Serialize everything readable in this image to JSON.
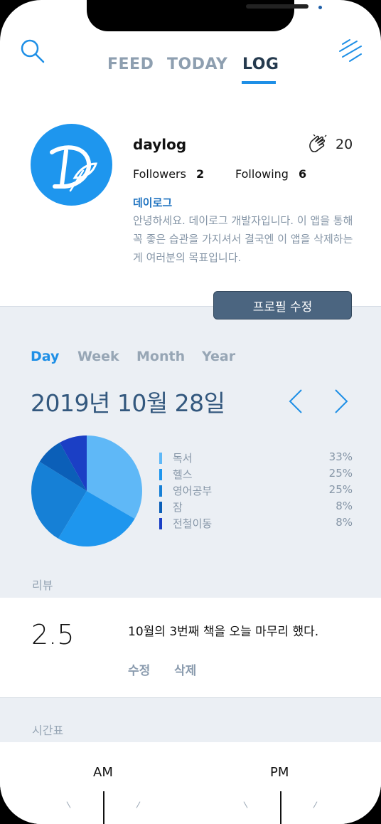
{
  "nav": {
    "tabs": [
      "FEED",
      "TODAY",
      "LOG"
    ],
    "active_tab": "LOG"
  },
  "profile": {
    "username": "daylog",
    "clap_count": "20",
    "followers_label": "Followers",
    "followers_count": "2",
    "following_label": "Following",
    "following_count": "6",
    "display_name": "데이로그",
    "bio": "안녕하세요. 데이로그 개발자입니다. 이 앱을 통해 꼭 좋은 습관을 가지셔서 결국엔 이 앱을 삭제하는게 여러분의 목표입니다.",
    "edit_button": "프로필 수정"
  },
  "periods": [
    "Day",
    "Week",
    "Month",
    "Year"
  ],
  "active_period": "Day",
  "current_date": "2019년 10월 28일",
  "chart_data": {
    "type": "pie",
    "labels": [
      "독서",
      "헬스",
      "영어공부",
      "잠",
      "전철이동"
    ],
    "values": [
      33,
      25,
      25,
      8,
      8
    ],
    "value_labels": [
      "33%",
      "25%",
      "25%",
      "8%",
      "8%"
    ],
    "colors": [
      "#5fb8f7",
      "#1e96ee",
      "#1680d6",
      "#0b5fb8",
      "#1b3fc5"
    ]
  },
  "review": {
    "section_label": "리뷰",
    "score": "2.5",
    "text": "10월의 3번째 책을 오늘 마무리 했다.",
    "edit_label": "수정",
    "delete_label": "삭제"
  },
  "timetable": {
    "section_label": "시간표",
    "am_label": "AM",
    "pm_label": "PM"
  },
  "icons": {
    "search": "search-icon",
    "menu": "menu-icon",
    "clap": "clap-icon",
    "prev": "chevron-left-icon",
    "next": "chevron-right-icon"
  },
  "colors": {
    "accent": "#1e8fe6",
    "brand": "#1e96ee",
    "button": "#4b6580",
    "background_gray": "#ebeff4"
  }
}
